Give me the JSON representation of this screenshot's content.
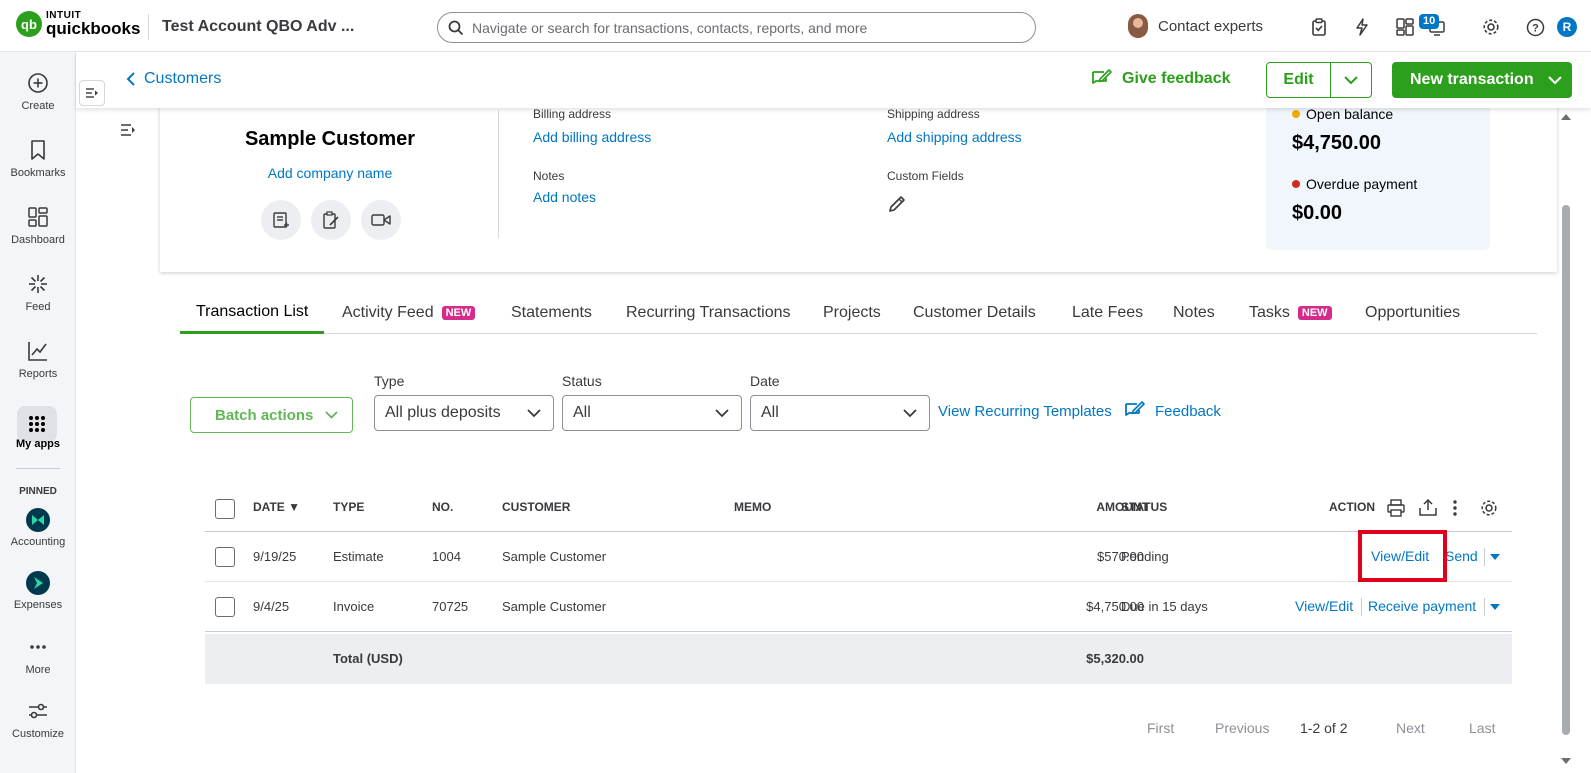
{
  "topbar": {
    "logo_brand": "INTUIT",
    "logo_product": "quickbooks",
    "logo_mark": "qb",
    "company_name": "Test Account QBO Adv ...",
    "search_placeholder": "Navigate or search for transactions, contacts, reports, and more",
    "contact_experts": "Contact experts",
    "notification_count": "10",
    "user_initial": "R"
  },
  "leftnav": {
    "items": [
      {
        "label": "Create",
        "icon": "plus-circle-icon"
      },
      {
        "label": "Bookmarks",
        "icon": "bookmark-icon"
      },
      {
        "label": "Dashboard",
        "icon": "dashboard-icon"
      },
      {
        "label": "Feed",
        "icon": "feed-icon"
      },
      {
        "label": "Reports",
        "icon": "chart-line-icon"
      },
      {
        "label": "My apps",
        "icon": "grid-dots-icon"
      }
    ],
    "pinned_label": "PINNED",
    "pinned": [
      {
        "label": "Accounting",
        "icon": "accounting-icon"
      },
      {
        "label": "Expenses",
        "icon": "expenses-icon"
      }
    ],
    "more_label": "More",
    "customize_label": "Customize"
  },
  "header": {
    "back_label": "Customers",
    "give_feedback": "Give feedback",
    "edit_label": "Edit",
    "new_transaction": "New transaction"
  },
  "customer": {
    "name": "Sample Customer",
    "add_company": "Add company name",
    "billing_label": "Billing address",
    "billing_link": "Add billing address",
    "shipping_label": "Shipping address",
    "shipping_link": "Add shipping address",
    "notes_label": "Notes",
    "notes_link": "Add notes",
    "custom_fields_label": "Custom Fields",
    "open_balance_label": "Open balance",
    "open_balance": "$4,750.00",
    "overdue_label": "Overdue payment",
    "overdue": "$0.00"
  },
  "colors": {
    "brand_green": "#2ca01c",
    "link_blue": "#0077c5",
    "new_badge": "#d52b8c",
    "open_dot": "#f2a900",
    "overdue_dot": "#d52b1e",
    "highlight": "#e0001b"
  },
  "tabs": [
    {
      "label": "Transaction List",
      "active": true
    },
    {
      "label": "Activity Feed",
      "badge": "NEW"
    },
    {
      "label": "Statements"
    },
    {
      "label": "Recurring Transactions"
    },
    {
      "label": "Projects"
    },
    {
      "label": "Customer Details"
    },
    {
      "label": "Late Fees"
    },
    {
      "label": "Notes"
    },
    {
      "label": "Tasks",
      "badge": "NEW"
    },
    {
      "label": "Opportunities"
    }
  ],
  "filters": {
    "batch_actions": "Batch actions",
    "type_label": "Type",
    "type_value": "All plus deposits",
    "status_label": "Status",
    "status_value": "All",
    "date_label": "Date",
    "date_value": "All",
    "view_recurring": "View Recurring Templates",
    "feedback": "Feedback"
  },
  "table": {
    "headers": {
      "date": "DATE ▼",
      "type": "TYPE",
      "no": "NO.",
      "customer": "CUSTOMER",
      "memo": "MEMO",
      "amount": "AMOUNT",
      "status": "STATUS",
      "action": "ACTION"
    },
    "rows": [
      {
        "date": "9/19/25",
        "type": "Estimate",
        "no": "1004",
        "customer": "Sample Customer",
        "memo": "",
        "amount": "$570.00",
        "status": "Pending",
        "action_primary": "View/Edit",
        "action_secondary": "Send"
      },
      {
        "date": "9/4/25",
        "type": "Invoice",
        "no": "70725",
        "customer": "Sample Customer",
        "memo": "",
        "amount": "$4,750.00",
        "status": "Due in 15 days",
        "action_primary": "View/Edit",
        "action_secondary": "Receive payment"
      }
    ],
    "total_label": "Total (USD)",
    "total_amount": "$5,320.00"
  },
  "pager": {
    "first": "First",
    "previous": "Previous",
    "range": "1-2 of 2",
    "next": "Next",
    "last": "Last"
  }
}
